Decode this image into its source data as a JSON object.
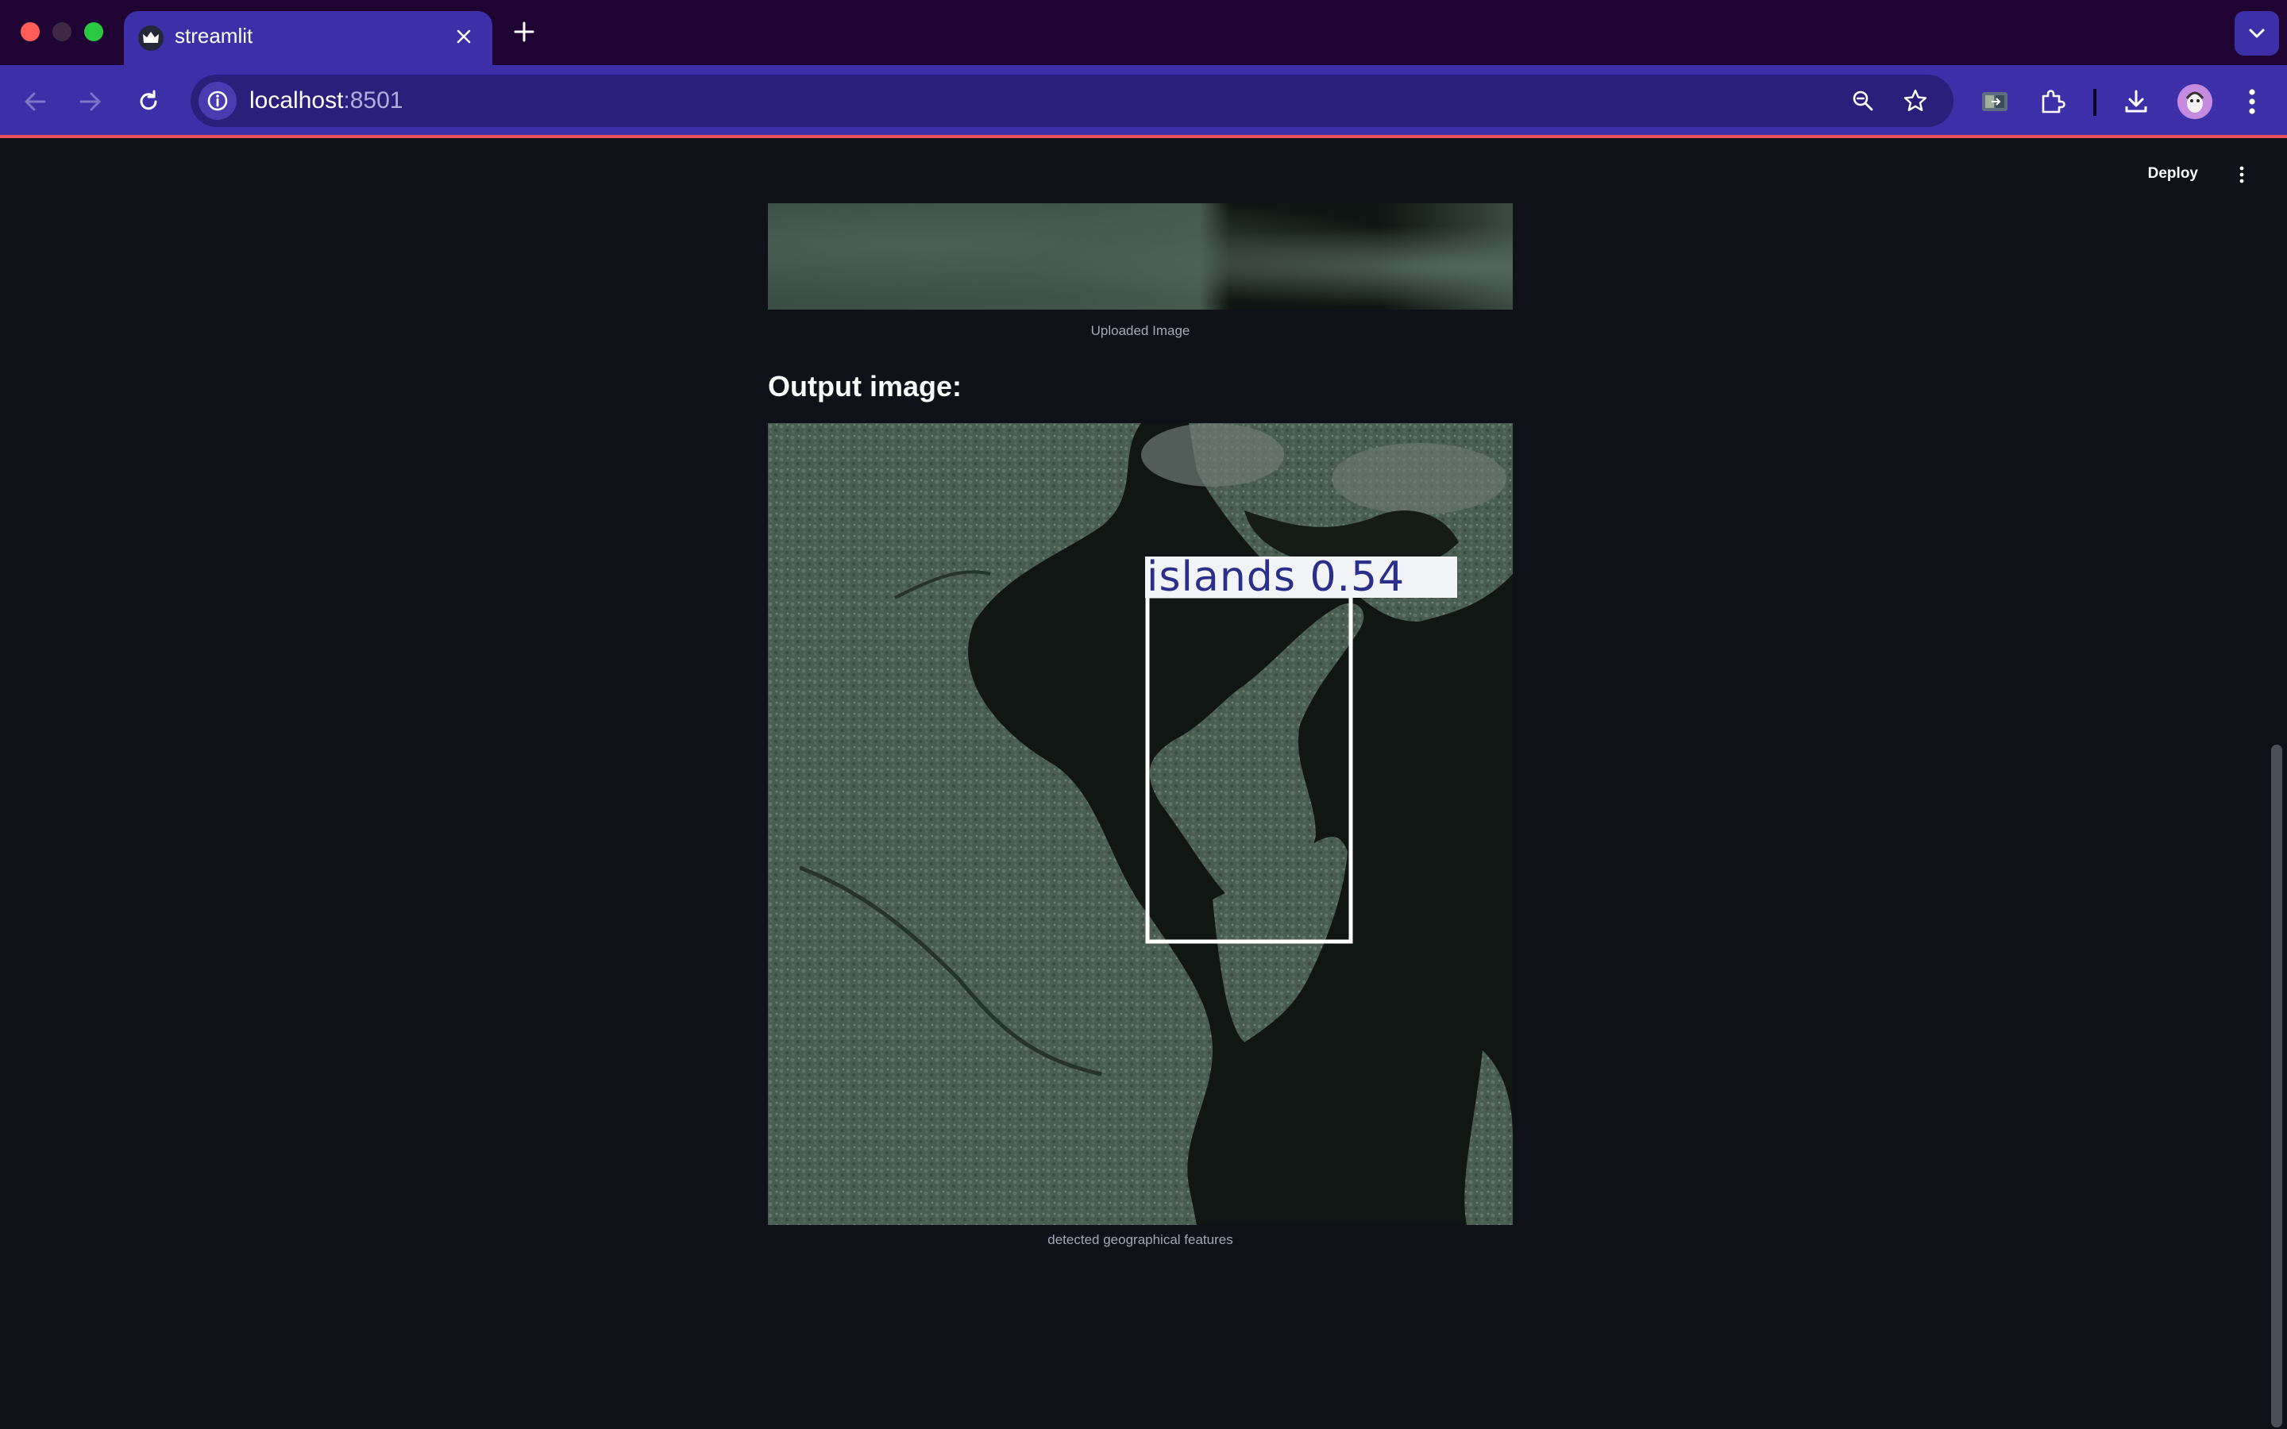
{
  "browser": {
    "tab": {
      "title": "streamlit",
      "favicon": "streamlit-crown-icon"
    },
    "url": {
      "host": "localhost",
      "port": ":8501"
    },
    "colors": {
      "tabbar": "#1f0433",
      "toolbar": "#3c2fa8",
      "omnibox": "#2a1f7a",
      "accent_line": "#e8505b"
    }
  },
  "app": {
    "deploy_label": "Deploy",
    "uploaded_caption": "Uploaded Image",
    "output_heading": "Output image:",
    "detection": {
      "label": "islands 0.54"
    },
    "output_caption": "detected geographical features",
    "colors": {
      "background": "#0e1117",
      "text": "#fafafa",
      "caption": "#a3a8b8"
    }
  }
}
